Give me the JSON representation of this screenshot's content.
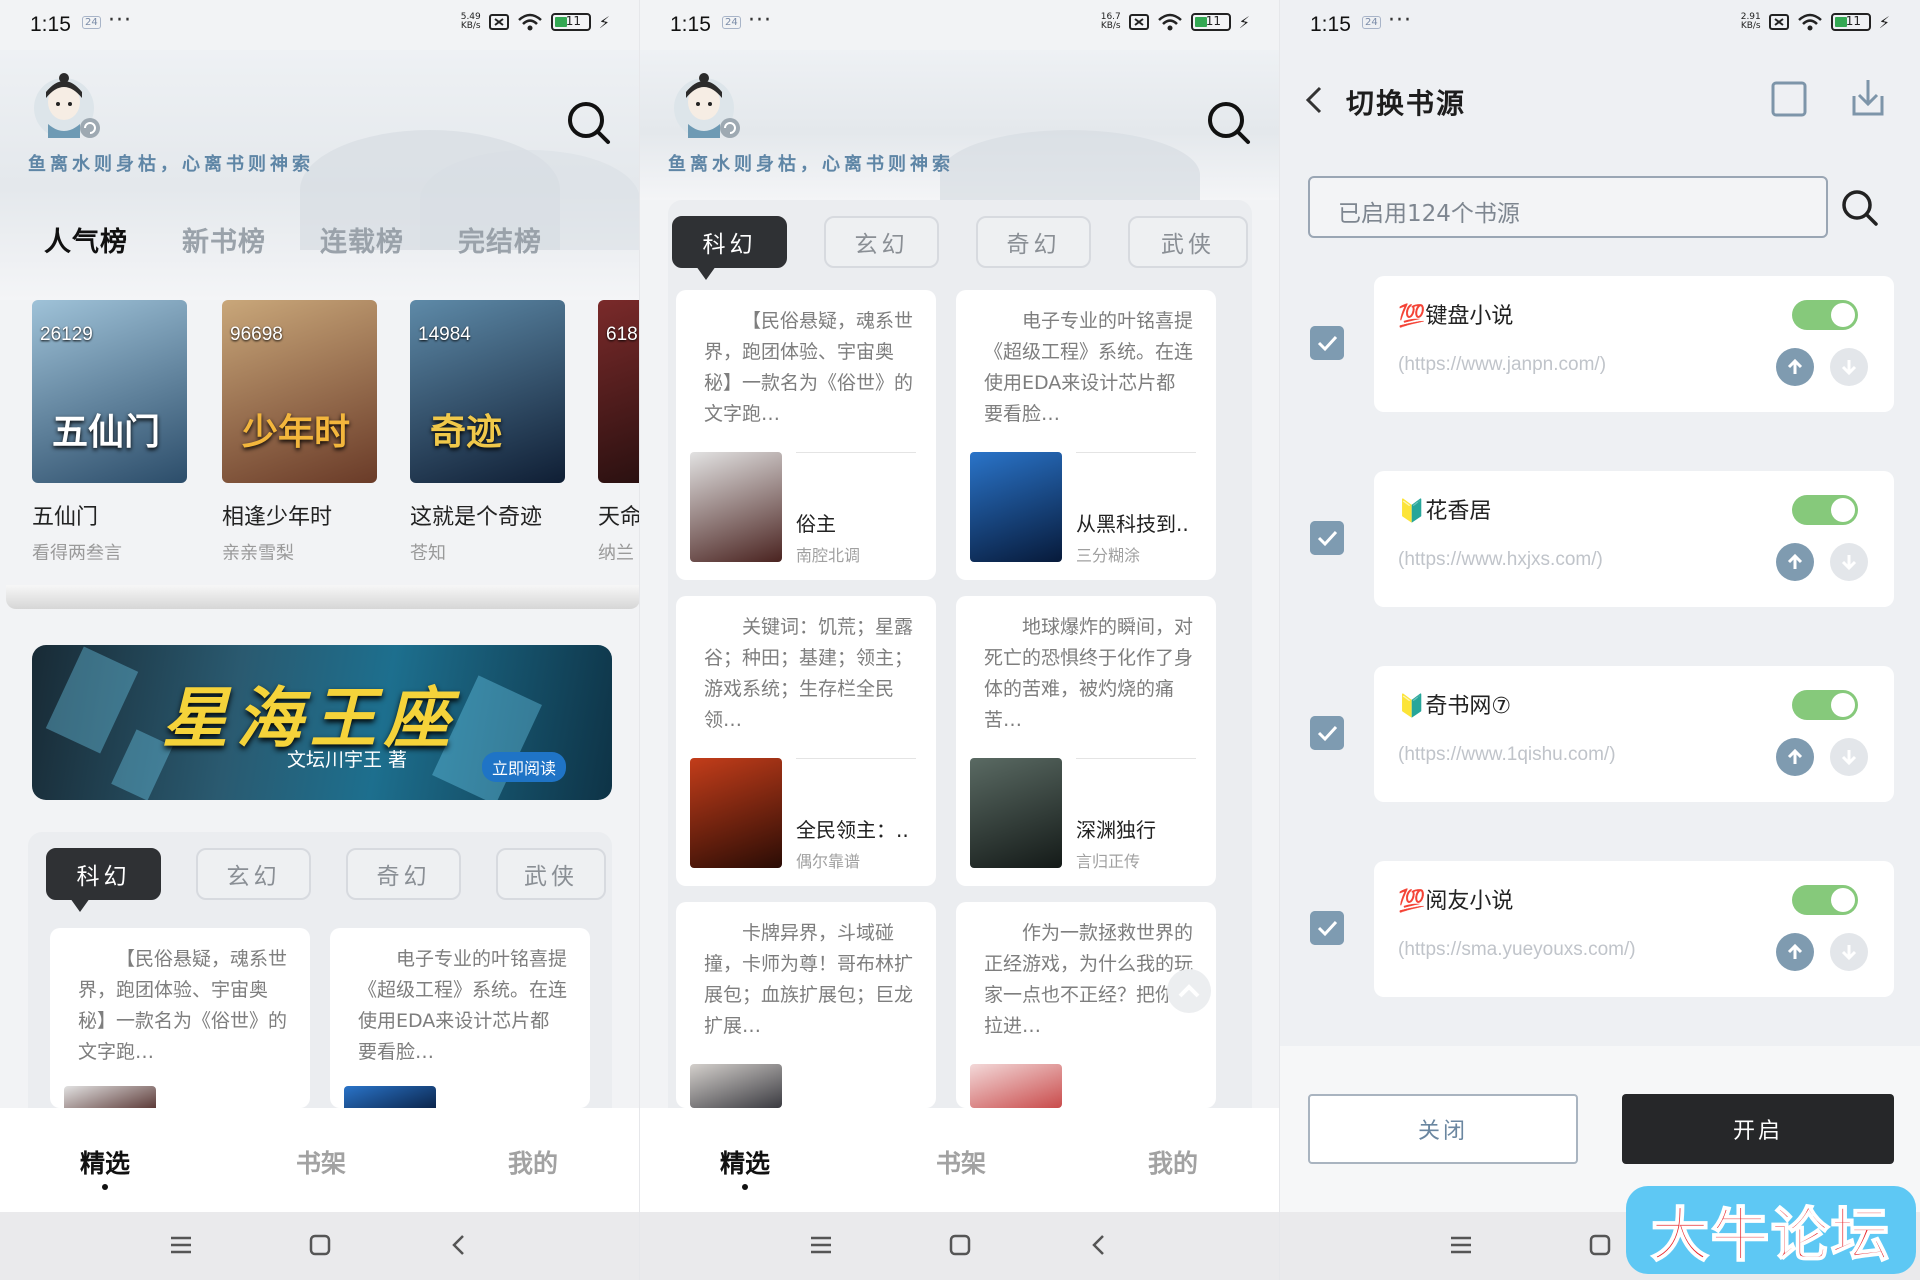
{
  "status_bars": [
    {
      "time": "1:15",
      "badge": "24",
      "speed_top": "5.49",
      "speed_bottom": "KB/s",
      "battery": "11"
    },
    {
      "time": "1:15",
      "badge": "24",
      "speed_top": "16.7",
      "speed_bottom": "KB/s",
      "battery": "11"
    },
    {
      "time": "1:15",
      "badge": "24",
      "speed_top": "2.91",
      "speed_bottom": "KB/s",
      "battery": "11"
    }
  ],
  "home": {
    "slogan": "鱼离水则身枯，心离书则神索",
    "rank_tabs": [
      "人气榜",
      "新书榜",
      "连载榜",
      "完结榜"
    ],
    "books": [
      {
        "count": "26129",
        "cover_text": "五仙门",
        "title": "五仙门",
        "author": "看得两叁言",
        "colors": [
          "#9fc2d8",
          "#2c4d6a"
        ]
      },
      {
        "count": "96698",
        "cover_text": "少年时",
        "title": "相逢少年时",
        "author": "亲亲雪梨",
        "colors": [
          "#c9a77a",
          "#6a3b28"
        ]
      },
      {
        "count": "14984",
        "cover_text": "奇迹",
        "title": "这就是个奇迹",
        "author": "苍知",
        "colors": [
          "#5e8aa8",
          "#0f1e34"
        ]
      },
      {
        "count": "618",
        "cover_text": "",
        "title": "天命",
        "author": "纳兰",
        "colors": [
          "#7a2a2a",
          "#1a0b0b"
        ]
      }
    ],
    "banner": {
      "title": "星海王座",
      "author": "文坛川宇王 著",
      "read": "立即阅读"
    }
  },
  "categories": [
    "科幻",
    "玄幻",
    "奇幻",
    "武侠"
  ],
  "feed_cards": [
    {
      "desc": "【民俗悬疑，魂系世界，跑团体验、宇宙奥秘】一款名为《俗世》的文字跑…",
      "title": "俗主",
      "author": "南腔北调",
      "colors": [
        "#e2e2e2",
        "#4a2320"
      ]
    },
    {
      "desc": "电子专业的叶铭喜提《超级工程》系统。在连使用EDA来设计芯片都要看脸…",
      "title": "从黑科技到..",
      "author": "三分糊涂",
      "colors": [
        "#2a74c9",
        "#071a3a"
      ]
    },
    {
      "desc": "关键词：饥荒；星露谷；种田；基建；领主；游戏系统；生存栏全民领…",
      "title": "全民领主：..",
      "author": "偶尔靠谱",
      "colors": [
        "#c33d1a",
        "#2a0c05"
      ]
    },
    {
      "desc": "地球爆炸的瞬间，对死亡的恐惧终于化作了身体的苦难，被灼烧的痛苦…",
      "title": "深渊独行",
      "author": "言归正传",
      "colors": [
        "#5a6a63",
        "#141a18"
      ]
    },
    {
      "desc": "卡牌异界，斗域碰撞，卡师为尊！哥布林扩展包；血族扩展包；巨龙扩展…",
      "title": "",
      "author": "",
      "colors": [
        "#d4d0cc",
        "#3a3a40"
      ]
    },
    {
      "desc": "作为一款拯救世界的正经游戏，为什么我的玩家一点也不正经？把你们拉进…",
      "title": "",
      "author": "",
      "colors": [
        "#f3d9d9",
        "#c94b4b"
      ]
    }
  ],
  "bottom_tabs": [
    "精选",
    "书架",
    "我的"
  ],
  "sources": {
    "title": "切换书源",
    "search_placeholder": "已启用124个书源",
    "items": [
      {
        "emoji": "💯",
        "name": "键盘小说",
        "url": "(https://www.janpn.com/)"
      },
      {
        "emoji": "🔰",
        "name": "花香居",
        "url": "(https://www.hxjxs.com/)"
      },
      {
        "emoji": "🔰",
        "name": "奇书网⑦",
        "url": "(https://www.1qishu.com/)"
      },
      {
        "emoji": "💯",
        "name": "阅友小说",
        "url": "(https://sma.yueyouxs.com/)"
      }
    ],
    "close_label": "关闭",
    "open_label": "开启"
  },
  "watermark": "大牛论坛",
  "colors": {
    "accent_dark": "#2f3134",
    "toggle_on": "#86c97b",
    "slogan": "#5f86a6",
    "check": "#7e9bb1"
  }
}
